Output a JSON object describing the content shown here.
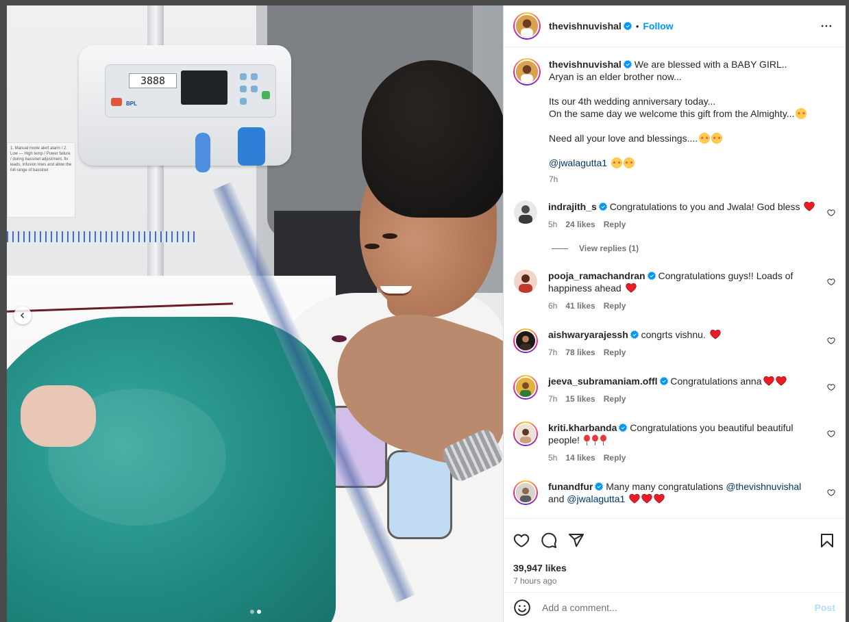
{
  "post": {
    "username": "thevishnuvishal",
    "follow_label": "Follow",
    "separator": "•",
    "caption_lines": [
      "We are blessed with a BABY GIRL..",
      "Aryan is an elder brother now...",
      "Its our 4th wedding anniversary today...",
      "On the same day we welcome this gift from the Almighty...",
      "Need all your love and blessings....",
      "@jwalagutta1"
    ],
    "caption_time": "7h",
    "likes": "39,947 likes",
    "posted": "7 hours ago",
    "pump_display": "3888",
    "pump_brand": "BPL",
    "sticker_text": "1. Manual mode alert alarm / 2. Low — High temp / Power failure / during bassinet adjustment, fix leads, infusion lines and allow the full range of bassinet"
  },
  "comments": [
    {
      "username": "indrajith_s",
      "verified": true,
      "text": "Congratulations to you and Jwala! God bless",
      "time": "5h",
      "likes": "24 likes",
      "reply": "Reply",
      "view_replies": "View replies (1)"
    },
    {
      "username": "pooja_ramachandran",
      "verified": true,
      "text_1": "Congratulations guys!! Loads of",
      "text_2": "happiness ahead",
      "time": "6h",
      "likes": "41 likes",
      "reply": "Reply"
    },
    {
      "username": "aishwaryarajessh",
      "verified": true,
      "text": "congrts vishnu.",
      "time": "7h",
      "likes": "78 likes",
      "reply": "Reply"
    },
    {
      "username": "jeeva_subramaniam.offl",
      "verified": true,
      "text": "Congratulations anna",
      "time": "7h",
      "likes": "15 likes",
      "reply": "Reply"
    },
    {
      "username": "kriti.kharbanda",
      "verified": true,
      "text_1": "Congratulations you beautiful beautiful",
      "text_2": "people!",
      "time": "5h",
      "likes": "14 likes",
      "reply": "Reply"
    },
    {
      "username": "funandfur",
      "verified": true,
      "text_1": "Many many congratulations",
      "mention_1": "@thevishnuvishal",
      "text_2": "and",
      "mention_2": "@jwalagutta1"
    }
  ],
  "add_comment": {
    "placeholder": "Add a comment...",
    "post_label": "Post"
  },
  "colors": {
    "link": "#0095f6",
    "mention": "#00376b",
    "muted": "#737373",
    "heart": "#ed1c24"
  },
  "icons": [
    "verified-icon",
    "more-icon",
    "heart-icon",
    "comment-icon",
    "share-icon",
    "save-icon",
    "emoji-icon",
    "chevron-left-icon"
  ]
}
